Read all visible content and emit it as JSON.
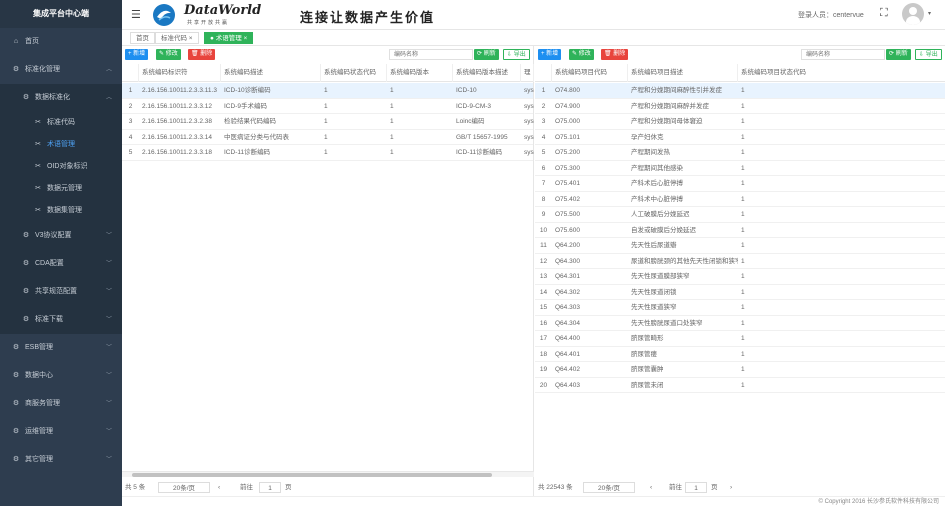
{
  "sidebar": {
    "brand": "集成平台中心端",
    "items": [
      {
        "label": "首页",
        "icon": "home-icon"
      },
      {
        "label": "标准化管理",
        "icon": "gear-icon"
      },
      {
        "label": "数据标准化",
        "icon": "gear-icon"
      },
      {
        "label": "标准代码",
        "icon": "tools-icon"
      },
      {
        "label": "术语管理",
        "icon": "tools-icon"
      },
      {
        "label": "OID对象标识",
        "icon": "tools-icon"
      },
      {
        "label": "数据元管理",
        "icon": "tools-icon"
      },
      {
        "label": "数据集管理",
        "icon": "tools-icon"
      },
      {
        "label": "V3协议配置",
        "icon": "gear-icon"
      },
      {
        "label": "CDA配置",
        "icon": "gear-icon"
      },
      {
        "label": "共享规范配置",
        "icon": "gear-icon"
      },
      {
        "label": "标准下载",
        "icon": "gear-icon"
      },
      {
        "label": "ESB管理",
        "icon": "gear-icon"
      },
      {
        "label": "数据中心",
        "icon": "gear-icon"
      },
      {
        "label": "商服务管理",
        "icon": "gear-icon"
      },
      {
        "label": "运维管理",
        "icon": "gear-icon"
      },
      {
        "label": "其它管理",
        "icon": "gear-icon"
      }
    ]
  },
  "header": {
    "brand_name": "DataWorld",
    "brand_sub": "共享开放共赢",
    "slogan": "连接让数据产生价值",
    "user_label": "登录人员：centervue"
  },
  "tabs": [
    {
      "label": "首页"
    },
    {
      "label": "标准代码 ×"
    },
    {
      "label": "● 术语管理 ×"
    }
  ],
  "left": {
    "buttons": {
      "add": "+ 新增",
      "edit": "✎ 修改",
      "delete": "🗑 删除",
      "refresh": "⟳ 刷新",
      "export": "⇩ 导出"
    },
    "search_placeholder": "编码名称",
    "columns": [
      "",
      "系统编码标识符",
      "系统编码描述",
      "系统编码状态代码",
      "系统编码版本",
      "系统编码版本描述",
      "理"
    ],
    "rows": [
      [
        "1",
        "2.16.156.10011.2.3.3.11.3",
        "ICD-10诊断编码",
        "1",
        "1",
        "ICD-10",
        "sys"
      ],
      [
        "2",
        "2.16.156.10011.2.3.3.12",
        "ICD-9手术编码",
        "1",
        "1",
        "ICD-9-CM-3",
        "sys"
      ],
      [
        "3",
        "2.16.156.10011.2.3.2.38",
        "检验结果代码编码",
        "1",
        "1",
        "Loinc编码",
        "sys"
      ],
      [
        "4",
        "2.16.156.10011.2.3.3.14",
        "中医病证分类与代码表",
        "1",
        "1",
        "GB/T 15657-1995",
        "sys"
      ],
      [
        "5",
        "2.16.156.10011.2.3.3.18",
        "ICD-11诊断编码",
        "1",
        "1",
        "ICD-11诊断编码",
        "sys"
      ]
    ],
    "pager": {
      "total": "共 5 条",
      "per_page": "20条/页",
      "prev": "前往",
      "page": "1",
      "unit": "页"
    }
  },
  "right": {
    "buttons": {
      "add": "+ 新增",
      "edit": "✎ 修改",
      "delete": "🗑 删除",
      "refresh": "⟳ 刷新",
      "export": "⇩ 导出"
    },
    "search_placeholder": "编码名称",
    "columns": [
      "",
      "系统编码项目代码",
      "系统编码项目描述",
      "系统编码项目状态代码"
    ],
    "rows": [
      [
        "1",
        "O74.800",
        "产程和分娩期间麻醉性引并发症",
        "1"
      ],
      [
        "2",
        "O74.900",
        "产程和分娩期间麻醉并发症",
        "1"
      ],
      [
        "3",
        "O75.000",
        "产程和分娩期间母体窘迫",
        "1"
      ],
      [
        "4",
        "O75.101",
        "孕产妇休克",
        "1"
      ],
      [
        "5",
        "O75.200",
        "产程期间发热",
        "1"
      ],
      [
        "6",
        "O75.300",
        "产程期间其他感染",
        "1"
      ],
      [
        "7",
        "O75.401",
        "产科术后心脏停搏",
        "1"
      ],
      [
        "8",
        "O75.402",
        "产科术中心脏停搏",
        "1"
      ],
      [
        "9",
        "O75.500",
        "人工破膜后分娩延迟",
        "1"
      ],
      [
        "10",
        "O75.600",
        "自发或破膜后分娩延迟",
        "1"
      ],
      [
        "11",
        "Q64.200",
        "先天性后尿道瓣",
        "1"
      ],
      [
        "12",
        "Q64.300",
        "尿道和膀胱颈的其他先天性闭锁和狭窄",
        "1"
      ],
      [
        "13",
        "Q64.301",
        "先天性尿道膜部狭窄",
        "1"
      ],
      [
        "14",
        "Q64.302",
        "先天性尿道闭锁",
        "1"
      ],
      [
        "15",
        "Q64.303",
        "先天性尿道狭窄",
        "1"
      ],
      [
        "16",
        "Q64.304",
        "先天性膀胱尿道口处狭窄",
        "1"
      ],
      [
        "17",
        "Q64.400",
        "脐尿管畸形",
        "1"
      ],
      [
        "18",
        "Q64.401",
        "脐尿管瘘",
        "1"
      ],
      [
        "19",
        "Q64.402",
        "脐尿管囊肿",
        "1"
      ],
      [
        "20",
        "Q64.403",
        "脐尿管未闭",
        "1"
      ]
    ],
    "pager": {
      "total": "共 22543 条",
      "per_page": "20条/页",
      "prev": "前往",
      "page": "1",
      "unit": "页"
    }
  },
  "footer": "© Copyright 2016 长沙参氏软件科技有限公司"
}
